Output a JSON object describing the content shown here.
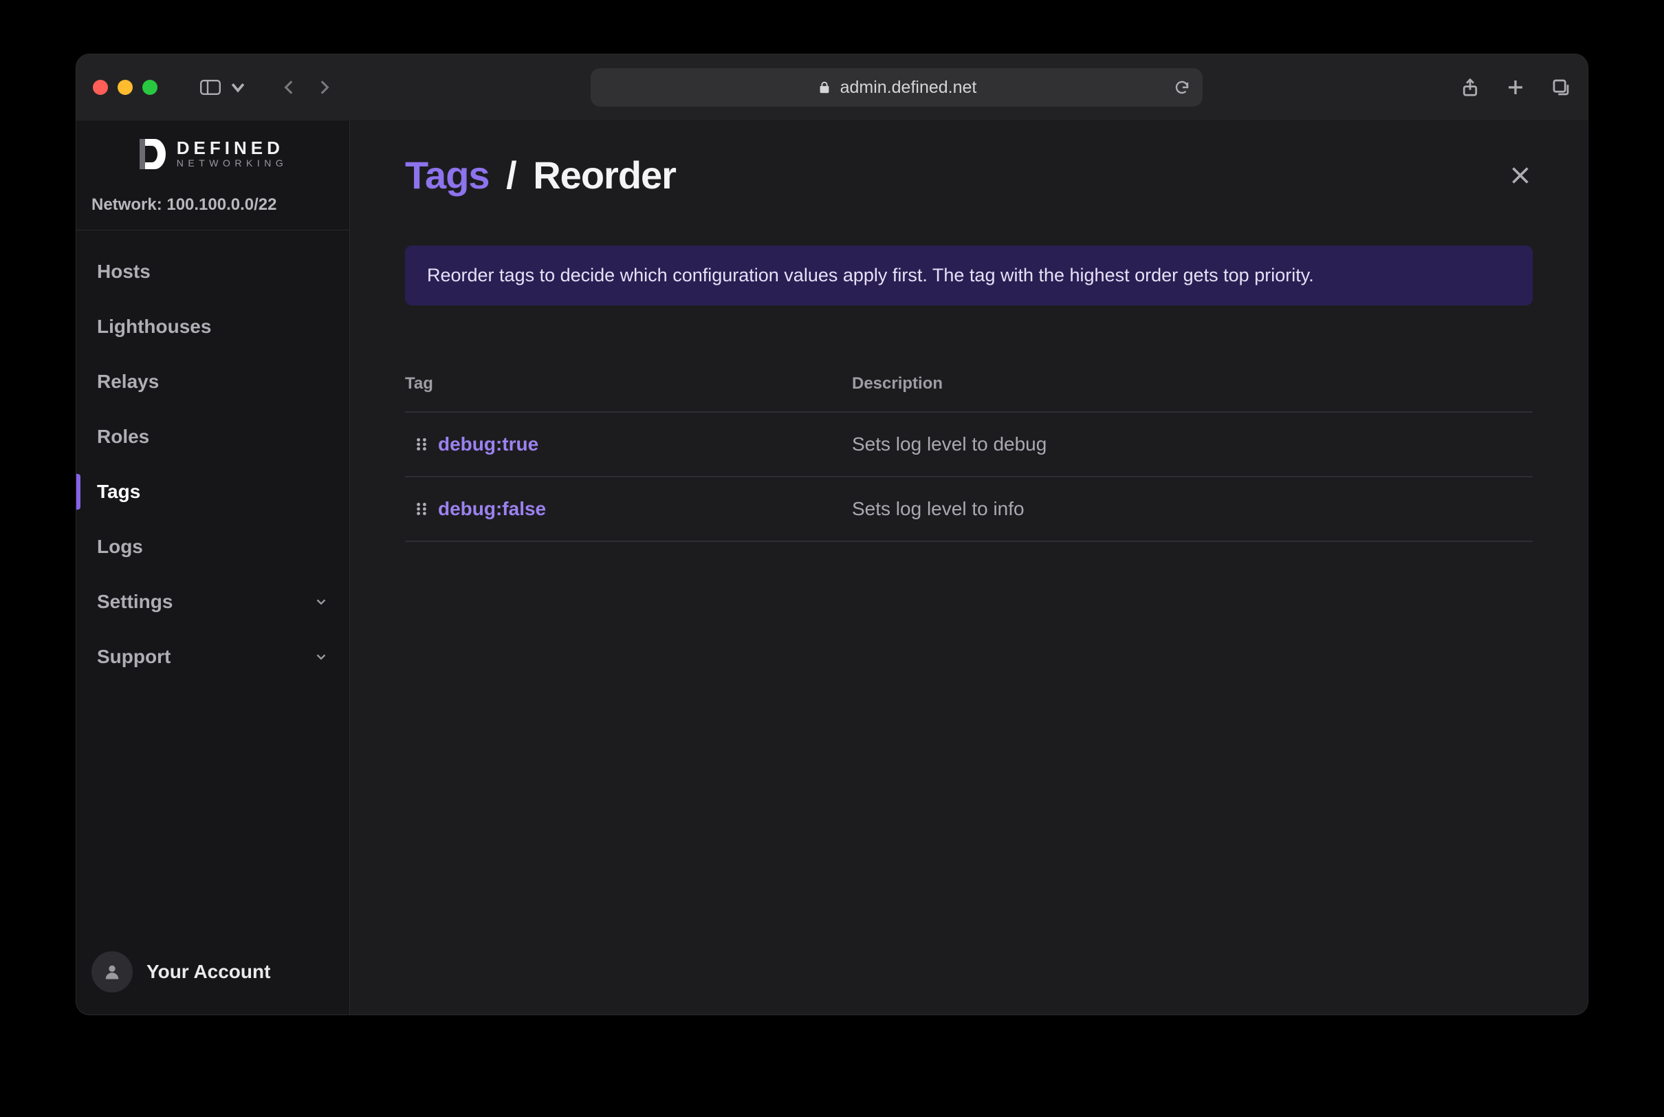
{
  "browser": {
    "url": "admin.defined.net"
  },
  "brand": {
    "line1": "DEFINED",
    "line2": "NETWORKING"
  },
  "sidebar": {
    "network_label": "Network: 100.100.0.0/22",
    "items": [
      {
        "label": "Hosts",
        "active": false,
        "expandable": false
      },
      {
        "label": "Lighthouses",
        "active": false,
        "expandable": false
      },
      {
        "label": "Relays",
        "active": false,
        "expandable": false
      },
      {
        "label": "Roles",
        "active": false,
        "expandable": false
      },
      {
        "label": "Tags",
        "active": true,
        "expandable": false
      },
      {
        "label": "Logs",
        "active": false,
        "expandable": false
      },
      {
        "label": "Settings",
        "active": false,
        "expandable": true
      },
      {
        "label": "Support",
        "active": false,
        "expandable": true
      }
    ],
    "account_label": "Your Account"
  },
  "page": {
    "breadcrumb_current": "Tags",
    "breadcrumb_separator": "/",
    "subtitle": "Reorder",
    "banner": "Reorder tags to decide which configuration values apply first. The tag with the highest order gets top priority.",
    "columns": {
      "tag": "Tag",
      "description": "Description"
    },
    "rows": [
      {
        "tag": "debug:true",
        "description": "Sets log level to debug"
      },
      {
        "tag": "debug:false",
        "description": "Sets log level to info"
      }
    ]
  }
}
